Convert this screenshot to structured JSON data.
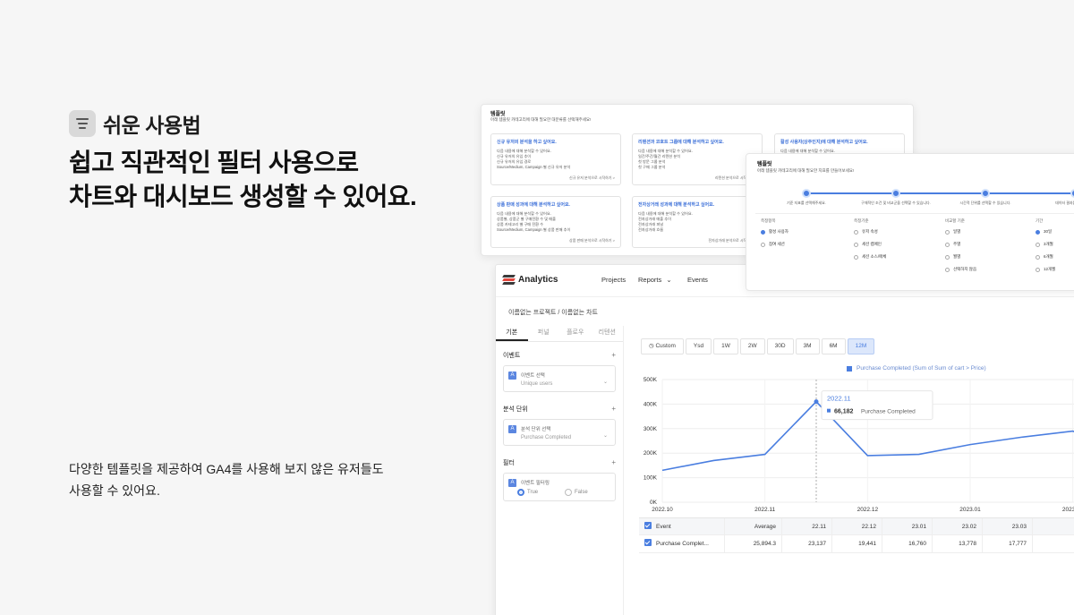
{
  "hero": {
    "badge": "쉬운 사용법",
    "title_line1": "쉽고 직관적인 필터 사용으로",
    "title_line2": "차트와 대시보드 생성할 수 있어요.",
    "desc_line1": "다양한 템플릿을 제공하여 GA4를 사용해 보지 않은 유저들도",
    "desc_line2": "사용할 수 있어요."
  },
  "templates": {
    "title": "템플릿",
    "subtitle": "아래 템플릿 카테고리에 대해 필요한 대분류를 선택해주세요!",
    "cards": [
      {
        "title": "신규 유저의 분석을 하고 싶어요.",
        "lines": [
          "다음 내용에 대해 분석할 수 있어요.",
          "신규 유저의 유입 추이",
          "신규 유저의 유입 경로",
          "Source/Medium, Campaign 별 신규 유저 분석"
        ],
        "link": "신규 유저 분석으로 시작하기 >"
      },
      {
        "title": "리텐션과 코호트 그룹에 대해 분석하고 싶어요.",
        "lines": [
          "다음 내용에 대해 분석할 수 있어요.",
          "일간/주간/월간 리텐션 분석",
          "첫 방문 그룹 분석",
          "첫 구매 그룹 분석"
        ],
        "link": "리텐션 분석으로 시작하기 >"
      },
      {
        "title": "활성 사용자(상주인지)에 대해 분석하고 싶어요.",
        "lines": [
          "다음 내용에 대해 분석할 수 있어요."
        ],
        "link": "활성 분석으로 시작 >"
      },
      {
        "title": "상품 판매 성과에 대해 분석하고 싶어요.",
        "lines": [
          "다음 내용에 대해 분석할 수 있어요.",
          "상품별, 상품군 별 구매전환 수 및 매출",
          "상품 카테고리 별 구매 전환 수",
          "Source/Medium, Campaign 별 상품 판매 추이"
        ],
        "link": "상품 판매 분석으로 시작하기 >"
      },
      {
        "title": "전자상거래 성과에 대해 분석하고 싶어요.",
        "lines": [
          "다음 내용에 대해 분석할 수 있어요.",
          "전자상거래 매출 추이",
          "전자상거래 퍼널",
          "전자상거래 흐름"
        ],
        "link": "전자상거래 분석으로 시작하기 >"
      }
    ]
  },
  "wizard": {
    "title": "템플릿",
    "subtitle": "아래 템플릿 카테고리에 대해 필요한 지표를 만들어보세요!",
    "steps": [
      "기준 지표를 선택해주세요.",
      "구체적인 조건 및 비교군을 선택할 수 있습니다.",
      "시간적 단위를 선택할 수 있습니다.",
      "데이터 결과를 확인하세요."
    ],
    "columns": [
      {
        "header": "측정항목",
        "options": [
          "활성 사용자",
          "참여 세션"
        ],
        "selected": 0
      },
      {
        "header": "측정기준",
        "options": [
          "유저 속성",
          "세션 캠페인",
          "세션 소스/매체"
        ],
        "selected": -1
      },
      {
        "header": "비교할 기준",
        "options": [
          "일별",
          "주별",
          "월별",
          "선택하지 않음"
        ],
        "selected": -1
      },
      {
        "header": "기간",
        "options": [
          "30일",
          "3개월",
          "6개월",
          "12개월"
        ],
        "selected": 0
      }
    ]
  },
  "analytics": {
    "logo": "Analytics",
    "nav": {
      "projects": "Projects",
      "reports": "Reports",
      "events": "Events"
    },
    "breadcrumb": "이름없는 프로젝트 / 이름없는 차트",
    "side_tabs": [
      "기본",
      "퍼널",
      "플로우",
      "리텐션"
    ],
    "event_section": "이벤트",
    "event_select_label": "이벤트 선택",
    "event_select_value": "Unique users",
    "unit_section": "분석 단위",
    "unit_select_label": "분석 단위 선택",
    "unit_select_value": "Purchase Completed",
    "filter_section": "필터",
    "filter_label": "이벤트 필터링",
    "filter_true": "True",
    "filter_false": "False",
    "ranges": [
      "Custom",
      "Ysd",
      "1W",
      "2W",
      "30D",
      "3M",
      "6M",
      "12M"
    ],
    "selected_range": "12M",
    "legend": "Purchase Completed (Sum of Sum of cart > Price)",
    "tooltip_title": "2022.11",
    "tooltip_value": "66,182",
    "tooltip_label": "Purchase Completed",
    "table": {
      "headers": [
        "Event",
        "Average",
        "22.11",
        "22.12",
        "23.01",
        "23.02",
        "23.03"
      ],
      "rows": [
        [
          "Purchase Complet...",
          "25,894.3",
          "23,137",
          "19,441",
          "16,760",
          "13,778",
          "17,777"
        ]
      ]
    }
  },
  "chart_data": {
    "type": "line",
    "x": [
      "2022.10",
      "",
      "2022.11",
      "",
      "2022.12",
      "",
      "2023.01",
      "",
      "2023.02",
      ""
    ],
    "xticks": [
      "2022.10",
      "2022.11",
      "2022.12",
      "2023.01",
      "2023.02"
    ],
    "yticks": [
      "0K",
      "100K",
      "200K",
      "300K",
      "400K",
      "500K"
    ],
    "ylim": [
      0,
      500000
    ],
    "series": [
      {
        "name": "Purchase Completed (Sum of Sum of cart > Price)",
        "values": [
          130000,
          170000,
          195000,
          410000,
          190000,
          195000,
          235000,
          265000,
          290000,
          195000
        ]
      }
    ],
    "color": "#4a7ee0"
  }
}
